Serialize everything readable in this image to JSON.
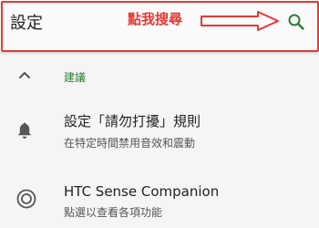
{
  "header": {
    "title": "設定",
    "annotation": "點我搜尋",
    "search_icon": "search-icon",
    "accent_color": "#2e7d32",
    "annotation_color": "#e53935"
  },
  "section": {
    "label": "建議",
    "collapse_icon": "chevron-up-icon"
  },
  "items": [
    {
      "title": "設定「請勿打擾」規則",
      "subtitle": "在特定時間禁用音效和震動",
      "icon": "bell-icon"
    },
    {
      "title": "HTC Sense Companion",
      "subtitle": "點選以查看各項功能",
      "icon": "companion-icon"
    }
  ]
}
